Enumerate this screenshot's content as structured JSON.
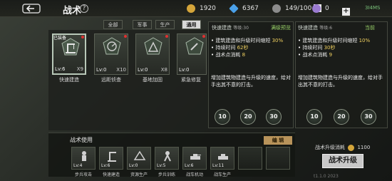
{
  "header": {
    "title": "战术",
    "help": "?",
    "resources": [
      {
        "name": "gold",
        "value": "1920",
        "color": "#d4a53a"
      },
      {
        "name": "diamond",
        "value": "6367",
        "color": "#4aa0e8"
      },
      {
        "name": "population",
        "value": "149/100",
        "color": "#c9c9c9"
      },
      {
        "name": "honor",
        "value": "0",
        "color": "#9a7ad0"
      }
    ],
    "system": "3I4MS"
  },
  "tabs": [
    {
      "label": "全部",
      "active": false
    },
    {
      "label": "军事",
      "active": false
    },
    {
      "label": "生产",
      "active": false
    },
    {
      "label": "通用",
      "active": true
    }
  ],
  "cards": [
    {
      "name": "快速建造",
      "level": "Lv:6",
      "count": "X9",
      "selected": true,
      "tag": "已装备"
    },
    {
      "name": "远距侦查",
      "level": "Lv:0",
      "count": "X10",
      "selected": false
    },
    {
      "name": "基地加固",
      "level": "Lv:0",
      "count": "X8",
      "selected": false
    },
    {
      "name": "紧急修复",
      "level": "Lv:0",
      "count": "",
      "selected": false
    }
  ],
  "detail_current": {
    "heading": "快速建造",
    "level": "等级:30",
    "status": "满级预览",
    "effects": [
      {
        "label": "建筑建造和升级时间缩短",
        "value": "30%"
      },
      {
        "label": "持续时间",
        "value": "62秒"
      },
      {
        "label": "战术点消耗",
        "value": "8"
      }
    ],
    "description": "增加建筑物建造与升级的速度，给对手出其不意的打击。",
    "levels": [
      "10",
      "20",
      "30"
    ]
  },
  "detail_next": {
    "heading": "快速建造",
    "level": "等级:6",
    "status": "当前",
    "effects": [
      {
        "label": "建筑建造和升级时间缩短",
        "value": "10%"
      },
      {
        "label": "持续时间",
        "value": "30秒"
      },
      {
        "label": "战术点消耗",
        "value": "9"
      }
    ],
    "description": "增加建筑物建造与升级的速度，给对手出其不意的打击。",
    "levels": [
      "10",
      "20",
      "30"
    ]
  },
  "loadout": {
    "title": "战术使用",
    "edit_label": "编 辑",
    "slots": [
      {
        "name": "步兵攻击",
        "level": "Lv:4"
      },
      {
        "name": "快速建造",
        "level": "Lv:6"
      },
      {
        "name": "资源生产",
        "level": "Lv:0"
      },
      {
        "name": "步兵训练",
        "level": "Lv:5"
      },
      {
        "name": "战车机动",
        "level": "Lv:6"
      },
      {
        "name": "战车生产",
        "level": "Lv:11"
      },
      {
        "name": "",
        "level": ""
      },
      {
        "name": "",
        "level": ""
      }
    ]
  },
  "upgrade": {
    "cost_label": "战术升级消耗",
    "cost_value": "1100",
    "button_label": "战术升级"
  },
  "footer_text": "t1.1.0 2023"
}
